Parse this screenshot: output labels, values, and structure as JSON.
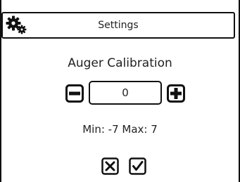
{
  "header": {
    "title": "Settings",
    "icon": "gears-icon"
  },
  "calibration": {
    "title": "Auger Calibration",
    "value": "0",
    "range_text": "Min: -7 Max: 7"
  },
  "actions": {
    "cancel_icon": "x-box-icon",
    "confirm_icon": "check-box-icon"
  },
  "colors": {
    "border": "#111111",
    "background": "#ffffff",
    "text": "#222222"
  }
}
